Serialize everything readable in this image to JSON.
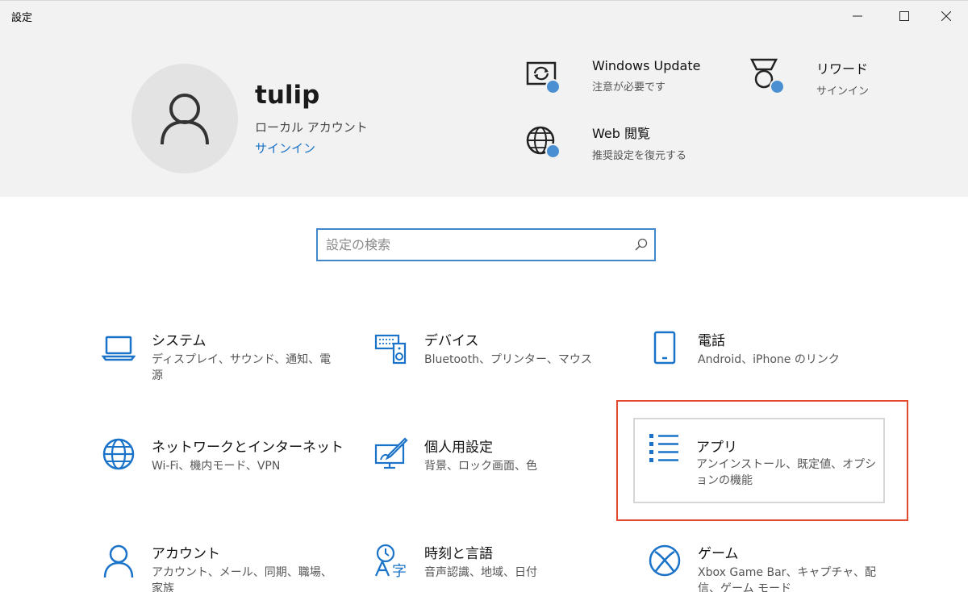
{
  "window": {
    "title": "設定",
    "controls": [
      "minimize-icon",
      "maximize-icon",
      "close-icon"
    ]
  },
  "profile": {
    "name": "tulip",
    "account_type": "ローカル アカウント",
    "signin_link": "サインイン"
  },
  "quick_links": [
    {
      "title": "Windows Update",
      "subtitle": "注意が必要です",
      "icon": "windows-update-icon"
    },
    {
      "title": "リワード",
      "subtitle": "サインイン",
      "icon": "rewards-icon"
    },
    {
      "title": "Web 閲覧",
      "subtitle": "推奨設定を復元する",
      "icon": "web-browsing-icon"
    }
  ],
  "search": {
    "placeholder": "設定の検索",
    "value": ""
  },
  "categories": [
    {
      "title": "システム",
      "subtitle": "ディスプレイ、サウンド、通知、電源",
      "icon": "laptop-icon"
    },
    {
      "title": "デバイス",
      "subtitle": "Bluetooth、プリンター、マウス",
      "icon": "devices-icon"
    },
    {
      "title": "電話",
      "subtitle": "Android、iPhone のリンク",
      "icon": "phone-icon"
    },
    {
      "title": "ネットワークとインターネット",
      "subtitle": "Wi-Fi、機内モード、VPN",
      "icon": "globe-icon"
    },
    {
      "title": "個人用設定",
      "subtitle": "背景、ロック画面、色",
      "icon": "personalization-icon"
    },
    {
      "title": "アプリ",
      "subtitle": "アンインストール、既定値、オプションの機能",
      "icon": "apps-list-icon"
    },
    {
      "title": "アカウント",
      "subtitle": "アカウント、メール、同期、職場、家族",
      "icon": "person-icon"
    },
    {
      "title": "時刻と言語",
      "subtitle": "音声認識、地域、日付",
      "icon": "time-language-icon"
    },
    {
      "title": "ゲーム",
      "subtitle": "Xbox Game Bar、キャプチャ、配信、ゲーム モード",
      "icon": "xbox-icon"
    }
  ],
  "colors": {
    "accent": "#3f87c9",
    "icon_blue": "#1a73c8",
    "header_bg": "#f2f2f2",
    "highlight": "#e2492f",
    "badge_dot": "#4a8fd1"
  }
}
